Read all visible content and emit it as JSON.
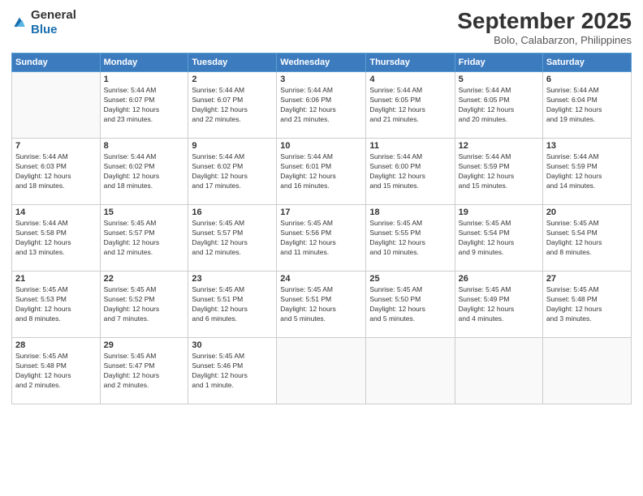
{
  "header": {
    "logo_general": "General",
    "logo_blue": "Blue",
    "month": "September 2025",
    "location": "Bolo, Calabarzon, Philippines"
  },
  "weekdays": [
    "Sunday",
    "Monday",
    "Tuesday",
    "Wednesday",
    "Thursday",
    "Friday",
    "Saturday"
  ],
  "weeks": [
    [
      {
        "day": "",
        "sunrise": "",
        "sunset": "",
        "daylight": ""
      },
      {
        "day": "1",
        "sunrise": "Sunrise: 5:44 AM",
        "sunset": "Sunset: 6:07 PM",
        "daylight": "Daylight: 12 hours and 23 minutes."
      },
      {
        "day": "2",
        "sunrise": "Sunrise: 5:44 AM",
        "sunset": "Sunset: 6:07 PM",
        "daylight": "Daylight: 12 hours and 22 minutes."
      },
      {
        "day": "3",
        "sunrise": "Sunrise: 5:44 AM",
        "sunset": "Sunset: 6:06 PM",
        "daylight": "Daylight: 12 hours and 21 minutes."
      },
      {
        "day": "4",
        "sunrise": "Sunrise: 5:44 AM",
        "sunset": "Sunset: 6:05 PM",
        "daylight": "Daylight: 12 hours and 21 minutes."
      },
      {
        "day": "5",
        "sunrise": "Sunrise: 5:44 AM",
        "sunset": "Sunset: 6:05 PM",
        "daylight": "Daylight: 12 hours and 20 minutes."
      },
      {
        "day": "6",
        "sunrise": "Sunrise: 5:44 AM",
        "sunset": "Sunset: 6:04 PM",
        "daylight": "Daylight: 12 hours and 19 minutes."
      }
    ],
    [
      {
        "day": "7",
        "sunrise": "Sunrise: 5:44 AM",
        "sunset": "Sunset: 6:03 PM",
        "daylight": "Daylight: 12 hours and 18 minutes."
      },
      {
        "day": "8",
        "sunrise": "Sunrise: 5:44 AM",
        "sunset": "Sunset: 6:02 PM",
        "daylight": "Daylight: 12 hours and 18 minutes."
      },
      {
        "day": "9",
        "sunrise": "Sunrise: 5:44 AM",
        "sunset": "Sunset: 6:02 PM",
        "daylight": "Daylight: 12 hours and 17 minutes."
      },
      {
        "day": "10",
        "sunrise": "Sunrise: 5:44 AM",
        "sunset": "Sunset: 6:01 PM",
        "daylight": "Daylight: 12 hours and 16 minutes."
      },
      {
        "day": "11",
        "sunrise": "Sunrise: 5:44 AM",
        "sunset": "Sunset: 6:00 PM",
        "daylight": "Daylight: 12 hours and 15 minutes."
      },
      {
        "day": "12",
        "sunrise": "Sunrise: 5:44 AM",
        "sunset": "Sunset: 5:59 PM",
        "daylight": "Daylight: 12 hours and 15 minutes."
      },
      {
        "day": "13",
        "sunrise": "Sunrise: 5:44 AM",
        "sunset": "Sunset: 5:59 PM",
        "daylight": "Daylight: 12 hours and 14 minutes."
      }
    ],
    [
      {
        "day": "14",
        "sunrise": "Sunrise: 5:44 AM",
        "sunset": "Sunset: 5:58 PM",
        "daylight": "Daylight: 12 hours and 13 minutes."
      },
      {
        "day": "15",
        "sunrise": "Sunrise: 5:45 AM",
        "sunset": "Sunset: 5:57 PM",
        "daylight": "Daylight: 12 hours and 12 minutes."
      },
      {
        "day": "16",
        "sunrise": "Sunrise: 5:45 AM",
        "sunset": "Sunset: 5:57 PM",
        "daylight": "Daylight: 12 hours and 12 minutes."
      },
      {
        "day": "17",
        "sunrise": "Sunrise: 5:45 AM",
        "sunset": "Sunset: 5:56 PM",
        "daylight": "Daylight: 12 hours and 11 minutes."
      },
      {
        "day": "18",
        "sunrise": "Sunrise: 5:45 AM",
        "sunset": "Sunset: 5:55 PM",
        "daylight": "Daylight: 12 hours and 10 minutes."
      },
      {
        "day": "19",
        "sunrise": "Sunrise: 5:45 AM",
        "sunset": "Sunset: 5:54 PM",
        "daylight": "Daylight: 12 hours and 9 minutes."
      },
      {
        "day": "20",
        "sunrise": "Sunrise: 5:45 AM",
        "sunset": "Sunset: 5:54 PM",
        "daylight": "Daylight: 12 hours and 8 minutes."
      }
    ],
    [
      {
        "day": "21",
        "sunrise": "Sunrise: 5:45 AM",
        "sunset": "Sunset: 5:53 PM",
        "daylight": "Daylight: 12 hours and 8 minutes."
      },
      {
        "day": "22",
        "sunrise": "Sunrise: 5:45 AM",
        "sunset": "Sunset: 5:52 PM",
        "daylight": "Daylight: 12 hours and 7 minutes."
      },
      {
        "day": "23",
        "sunrise": "Sunrise: 5:45 AM",
        "sunset": "Sunset: 5:51 PM",
        "daylight": "Daylight: 12 hours and 6 minutes."
      },
      {
        "day": "24",
        "sunrise": "Sunrise: 5:45 AM",
        "sunset": "Sunset: 5:51 PM",
        "daylight": "Daylight: 12 hours and 5 minutes."
      },
      {
        "day": "25",
        "sunrise": "Sunrise: 5:45 AM",
        "sunset": "Sunset: 5:50 PM",
        "daylight": "Daylight: 12 hours and 5 minutes."
      },
      {
        "day": "26",
        "sunrise": "Sunrise: 5:45 AM",
        "sunset": "Sunset: 5:49 PM",
        "daylight": "Daylight: 12 hours and 4 minutes."
      },
      {
        "day": "27",
        "sunrise": "Sunrise: 5:45 AM",
        "sunset": "Sunset: 5:48 PM",
        "daylight": "Daylight: 12 hours and 3 minutes."
      }
    ],
    [
      {
        "day": "28",
        "sunrise": "Sunrise: 5:45 AM",
        "sunset": "Sunset: 5:48 PM",
        "daylight": "Daylight: 12 hours and 2 minutes."
      },
      {
        "day": "29",
        "sunrise": "Sunrise: 5:45 AM",
        "sunset": "Sunset: 5:47 PM",
        "daylight": "Daylight: 12 hours and 2 minutes."
      },
      {
        "day": "30",
        "sunrise": "Sunrise: 5:45 AM",
        "sunset": "Sunset: 5:46 PM",
        "daylight": "Daylight: 12 hours and 1 minute."
      },
      {
        "day": "",
        "sunrise": "",
        "sunset": "",
        "daylight": ""
      },
      {
        "day": "",
        "sunrise": "",
        "sunset": "",
        "daylight": ""
      },
      {
        "day": "",
        "sunrise": "",
        "sunset": "",
        "daylight": ""
      },
      {
        "day": "",
        "sunrise": "",
        "sunset": "",
        "daylight": ""
      }
    ]
  ]
}
